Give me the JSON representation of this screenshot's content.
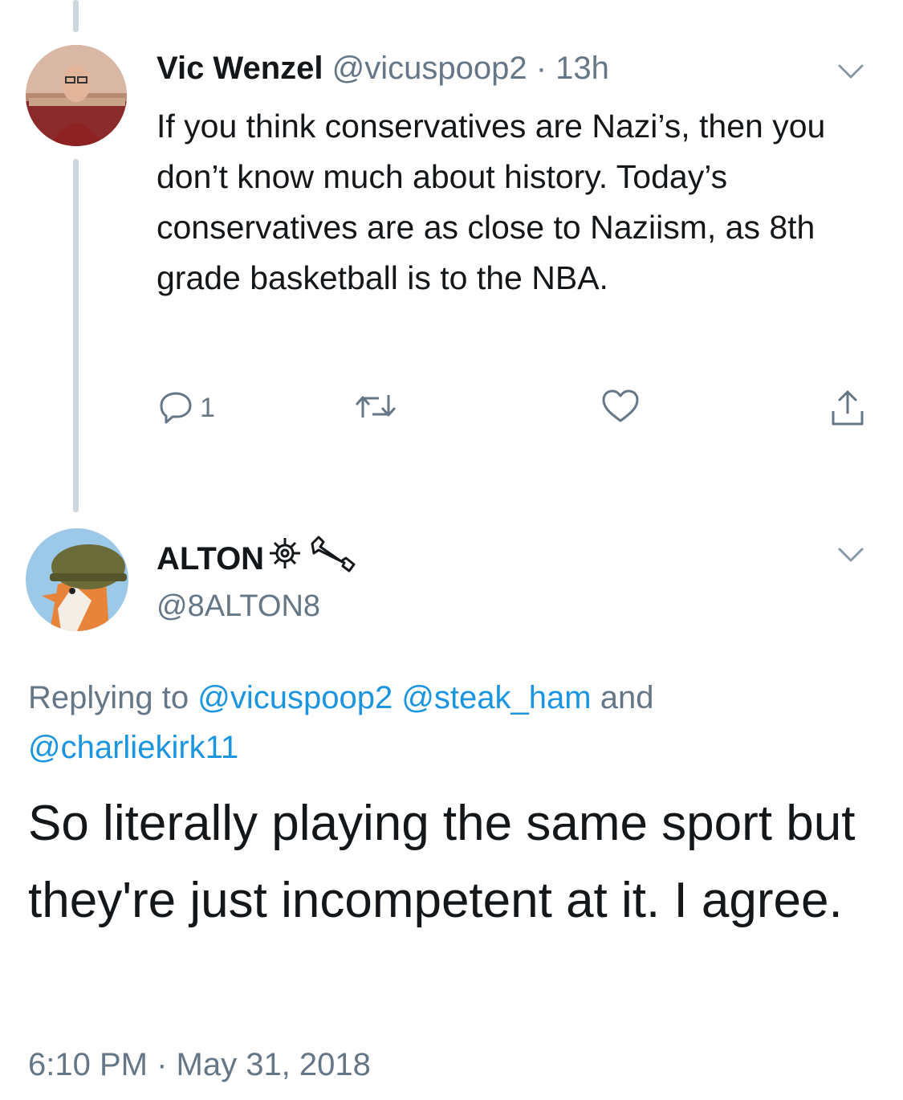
{
  "tweet1": {
    "name": "Vic Wenzel",
    "handle": "@vicuspoop2",
    "time_sep": " · ",
    "time": "13h",
    "text": "If you think conservatives are Nazi’s, then you don’t know much about history. Today’s conservatives are as close to Naziism, as 8th grade basketball is to the NBA.",
    "reply_count": "1"
  },
  "tweet2": {
    "name": "ALTON",
    "handle": "@8ALTON8",
    "replying_prefix": "Replying to ",
    "mention1": "@vicuspoop2",
    "mention2": "@steak_ham",
    "and_word": " and ",
    "mention3": "@charliekirk11",
    "text": "So literally playing the same sport but they're just incompetent at it. I agree.",
    "timestamp": "6:10 PM · May 31, 2018"
  },
  "icons": {
    "reply": "reply-icon",
    "retweet": "retweet-icon",
    "like": "heart-icon",
    "share": "share-icon",
    "chevron": "chevron-down-icon",
    "gear": "gear-icon",
    "wrench": "wrench-icon"
  },
  "colors": {
    "text": "#14171a",
    "secondary": "#657786",
    "link": "#1b95e0",
    "thread_line": "#ccd6dd"
  }
}
